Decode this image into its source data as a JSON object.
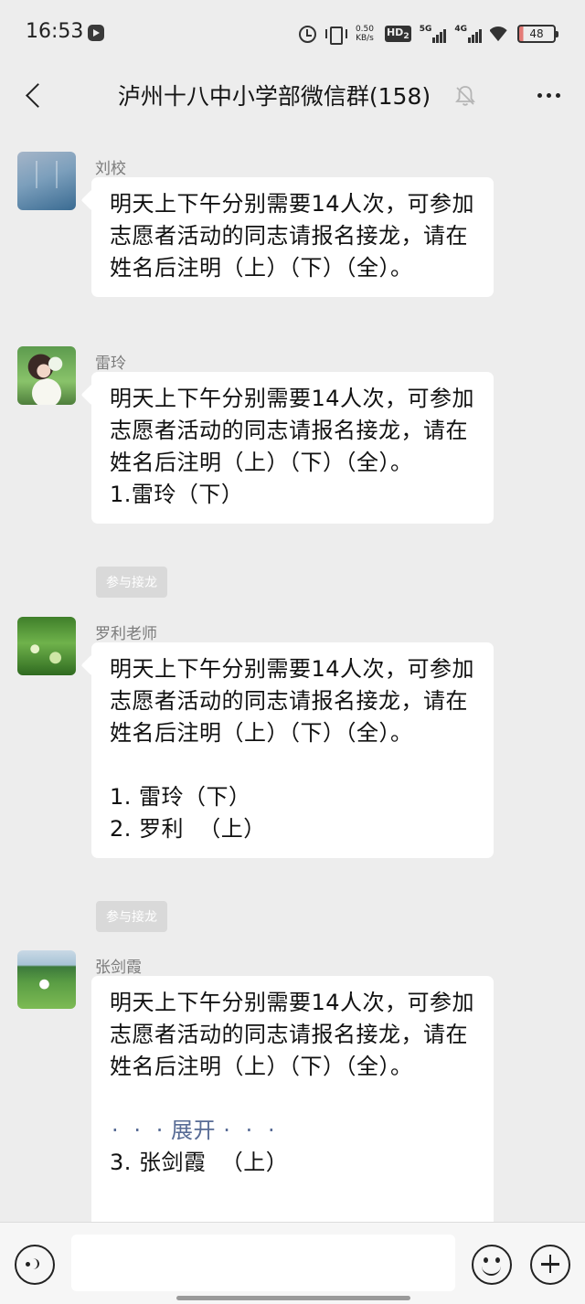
{
  "status_bar": {
    "time": "16:53",
    "net_speed_value": "0.50",
    "net_speed_unit": "KB/s",
    "hd_label": "HD",
    "hd_sub": "2",
    "net1_label": "5G",
    "net2_label": "4G",
    "battery": "48"
  },
  "header": {
    "title": "泸州十八中小学部微信群(158)",
    "mute_icon": "bell-off-icon",
    "back_icon": "chevron-left-icon",
    "more_icon": "more-dots-icon"
  },
  "messages": [
    {
      "sender": "刘校",
      "lines": [
        "明天上下午分别需要14人次，可参加志愿者活动的同志请报名接龙，请在姓名后注明（上）（下）（全）。"
      ],
      "join_label": ""
    },
    {
      "sender": "雷玲",
      "lines": [
        "明天上下午分别需要14人次，可参加志愿者活动的同志请报名接龙，请在姓名后注明（上）（下）（全）。",
        "1.雷玲（下）"
      ],
      "join_label": "参与接龙"
    },
    {
      "sender": "罗利老师",
      "lines": [
        "明天上下午分别需要14人次，可参加志愿者活动的同志请报名接龙，请在姓名后注明（上）（下）（全）。",
        "1. 雷玲（下）",
        "2. 罗利  （上）"
      ],
      "join_label": "参与接龙"
    },
    {
      "sender": "张剑霞",
      "lines": [
        "明天上下午分别需要14人次，可参加志愿者活动的同志请报名接龙，请在姓名后注明（上）（下）（全）。",
        "3. 张剑霞  （上）"
      ],
      "expand_label": "展开"
    }
  ],
  "input_bar": {
    "voice_icon": "voice-icon",
    "emoji_icon": "emoji-icon",
    "plus_icon": "plus-icon",
    "placeholder": ""
  },
  "colors": {
    "background": "#ededed",
    "bubble": "#ffffff",
    "link": "#576b95",
    "join_button": "#d9d9d9"
  }
}
